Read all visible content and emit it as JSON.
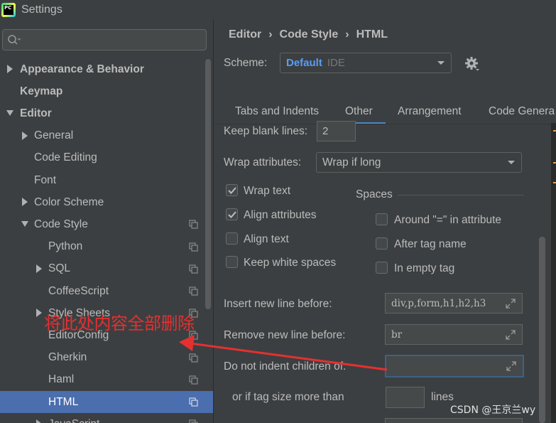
{
  "window": {
    "title": "Settings",
    "app_icon_text": "PC"
  },
  "search": {
    "placeholder": ""
  },
  "tree": [
    {
      "label": "Appearance & Behavior",
      "bold": true,
      "arrow": "right",
      "has_copy": false
    },
    {
      "label": "Keymap",
      "bold": true,
      "arrow": "none",
      "has_copy": false
    },
    {
      "label": "Editor",
      "bold": true,
      "arrow": "down",
      "has_copy": false
    },
    {
      "label": "General",
      "bold": false,
      "arrow": "right",
      "has_copy": false
    },
    {
      "label": "Code Editing",
      "bold": false,
      "arrow": "none",
      "has_copy": false
    },
    {
      "label": "Font",
      "bold": false,
      "arrow": "none",
      "has_copy": false
    },
    {
      "label": "Color Scheme",
      "bold": false,
      "arrow": "right",
      "has_copy": false
    },
    {
      "label": "Code Style",
      "bold": false,
      "arrow": "down",
      "has_copy": true
    },
    {
      "label": "Python",
      "bold": false,
      "arrow": "none",
      "has_copy": true
    },
    {
      "label": "SQL",
      "bold": false,
      "arrow": "right",
      "has_copy": true
    },
    {
      "label": "CoffeeScript",
      "bold": false,
      "arrow": "none",
      "has_copy": true
    },
    {
      "label": "Style Sheets",
      "bold": false,
      "arrow": "right",
      "has_copy": true
    },
    {
      "label": "EditorConfig",
      "bold": false,
      "arrow": "none",
      "has_copy": true
    },
    {
      "label": "Gherkin",
      "bold": false,
      "arrow": "none",
      "has_copy": true
    },
    {
      "label": "Haml",
      "bold": false,
      "arrow": "none",
      "has_copy": true
    },
    {
      "label": "HTML",
      "bold": false,
      "arrow": "none",
      "has_copy": true,
      "selected": true
    },
    {
      "label": "JavaScript",
      "bold": false,
      "arrow": "right",
      "has_copy": true
    }
  ],
  "breadcrumb": {
    "items": [
      "Editor",
      "Code Style",
      "HTML"
    ],
    "separator": "›"
  },
  "scheme": {
    "label": "Scheme:",
    "name": "Default",
    "kind": "IDE"
  },
  "tabs": [
    {
      "label": "Tabs and Indents",
      "active": false
    },
    {
      "label": "Other",
      "active": true
    },
    {
      "label": "Arrangement",
      "active": false
    },
    {
      "label": "Code Genera",
      "active": false
    }
  ],
  "other": {
    "keep_blank_lines_label": "Keep blank lines:",
    "keep_blank_lines_value": "2",
    "wrap_attributes_label": "Wrap attributes:",
    "wrap_attributes_value": "Wrap if long",
    "checkboxes_left": [
      {
        "label": "Wrap text",
        "checked": true
      },
      {
        "label": "Align attributes",
        "checked": true
      },
      {
        "label": "Align text",
        "checked": false
      },
      {
        "label": "Keep white spaces",
        "checked": false
      }
    ],
    "spaces_title": "Spaces",
    "checkboxes_spaces": [
      {
        "label": "Around \"=\" in attribute",
        "checked": false
      },
      {
        "label": "After tag name",
        "checked": false
      },
      {
        "label": "In empty tag",
        "checked": false
      }
    ],
    "insert_new_line_label": "Insert new line before:",
    "insert_new_line_value": "div,p,form,h1,h2,h3",
    "remove_new_line_label": "Remove new line before:",
    "remove_new_line_value": "br",
    "do_not_indent_label": "Do not indent children of:",
    "do_not_indent_value": "",
    "tag_size_label": "or if tag size more than",
    "tag_size_value": "",
    "lines_label": "lines"
  },
  "annotation": {
    "text": "将此处内容全部删除",
    "color": "#e53030"
  },
  "watermark": {
    "text": "CSDN @王京兰wy"
  },
  "colors": {
    "selection": "#4b6eaf",
    "accent_blue": "#589df6",
    "tab_underline": "#4a88c7",
    "panel_bg": "#3c3f41"
  }
}
